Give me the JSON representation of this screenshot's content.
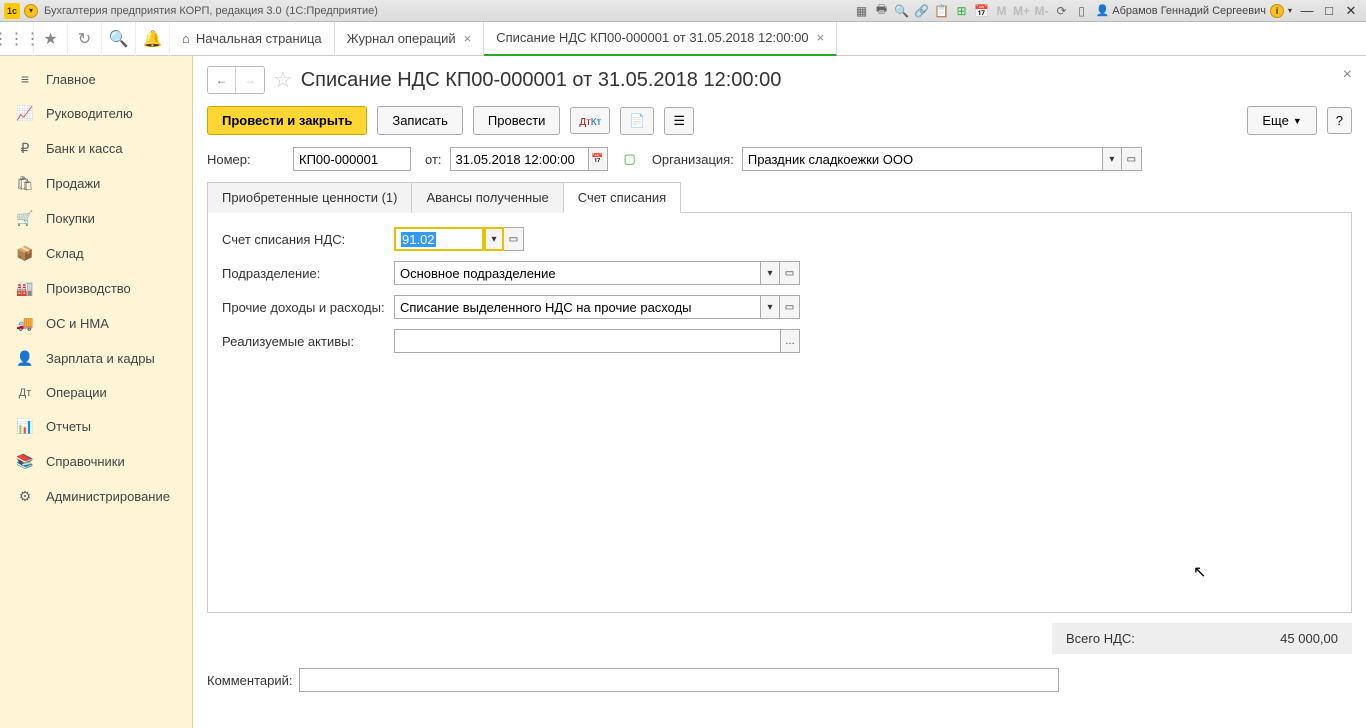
{
  "titlebar": {
    "app": "Бухгалтерия предприятия КОРП, редакция 3.0",
    "platform": "(1С:Предприятие)",
    "user": "Абрамов Геннадий Сергеевич",
    "m1": "M",
    "m2": "M+",
    "m3": "M-"
  },
  "top_tabs": {
    "home": "Начальная страница",
    "t1": "Журнал операций",
    "t2": "Списание НДС КП00-000001 от 31.05.2018 12:00:00"
  },
  "sidebar": [
    {
      "icon": "≡",
      "label": "Главное"
    },
    {
      "icon": "📈",
      "label": "Руководителю"
    },
    {
      "icon": "₽",
      "label": "Банк и касса"
    },
    {
      "icon": "🛍",
      "label": "Продажи"
    },
    {
      "icon": "🛒",
      "label": "Покупки"
    },
    {
      "icon": "📦",
      "label": "Склад"
    },
    {
      "icon": "🏭",
      "label": "Производство"
    },
    {
      "icon": "🚚",
      "label": "ОС и НМА"
    },
    {
      "icon": "👤",
      "label": "Зарплата и кадры"
    },
    {
      "icon": "Дт",
      "label": "Операции"
    },
    {
      "icon": "📊",
      "label": "Отчеты"
    },
    {
      "icon": "📚",
      "label": "Справочники"
    },
    {
      "icon": "⚙",
      "label": "Администрирование"
    }
  ],
  "doc": {
    "title": "Списание НДС КП00-000001 от 31.05.2018 12:00:00",
    "btn_post_close": "Провести и закрыть",
    "btn_save": "Записать",
    "btn_post": "Провести",
    "btn_more": "Еще",
    "lbl_number": "Номер:",
    "number": "КП00-000001",
    "lbl_date": "от:",
    "date": "31.05.2018 12:00:00",
    "lbl_org": "Организация:",
    "org": "Праздник сладкоежки ООО",
    "tabs": {
      "t1": "Приобретенные ценности (1)",
      "t2": "Авансы полученные",
      "t3": "Счет списания"
    },
    "fld_account": "Счет списания НДС:",
    "account": "91.02",
    "fld_dept": "Подразделение:",
    "dept": "Основное подразделение",
    "fld_other": "Прочие доходы и расходы:",
    "other": "Списание выделенного НДС на прочие расходы",
    "fld_assets": "Реализуемые активы:",
    "assets": "",
    "total_lbl": "Всего НДС:",
    "total_val": "45 000,00",
    "comment_lbl": "Комментарий:",
    "comment": ""
  }
}
